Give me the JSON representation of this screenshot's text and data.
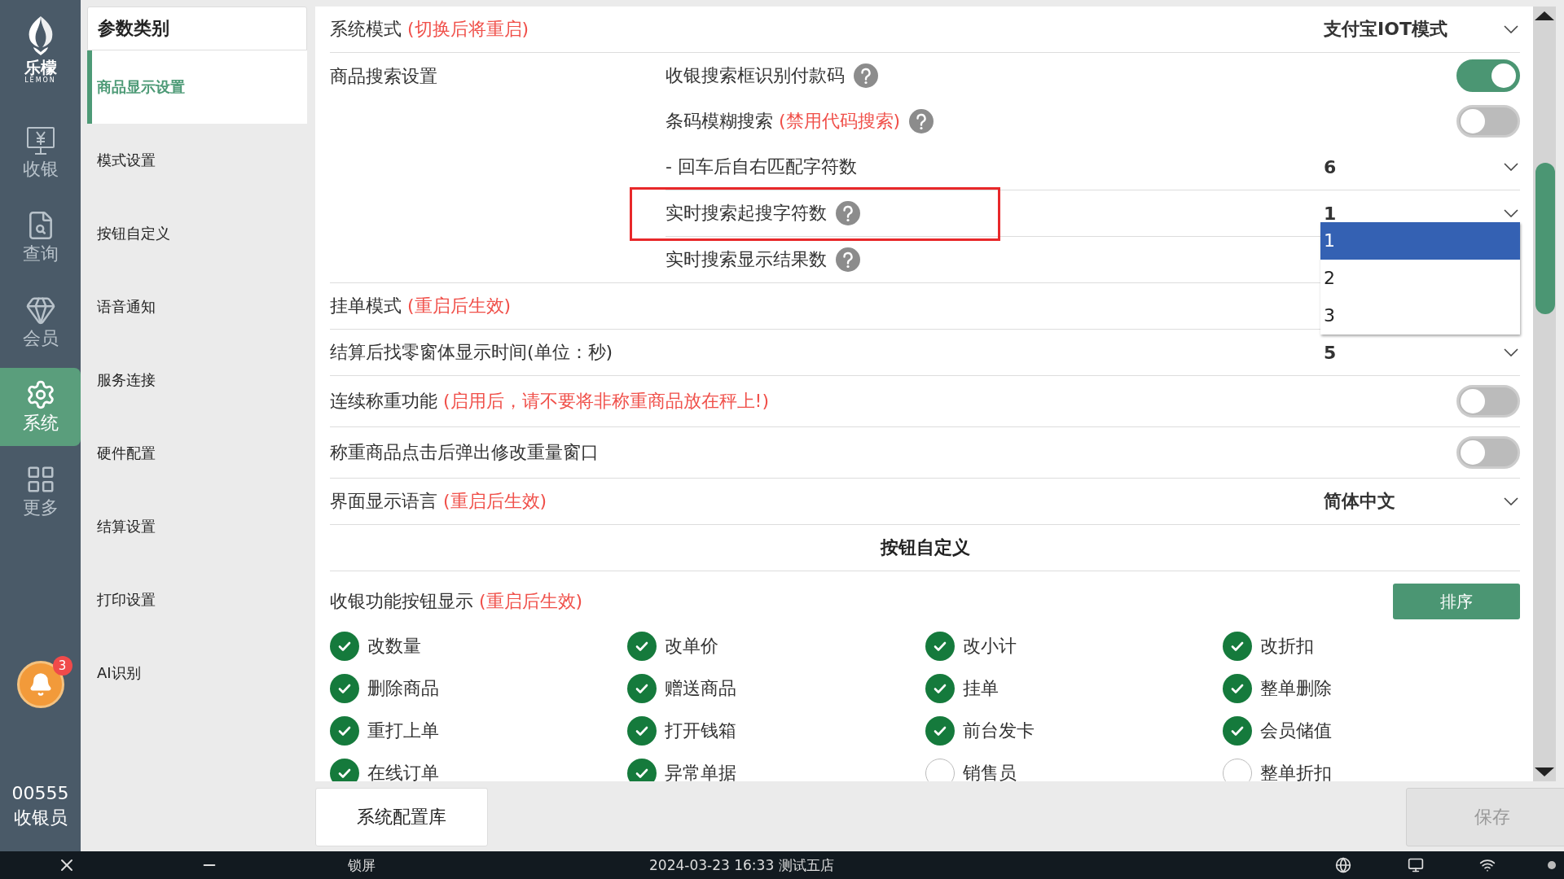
{
  "sidebar": {
    "logo": {
      "name": "乐檬",
      "subtitle": "LEMON"
    },
    "items": [
      {
        "label": "收银",
        "selected": false
      },
      {
        "label": "查询",
        "selected": false
      },
      {
        "label": "会员",
        "selected": false
      },
      {
        "label": "系统",
        "selected": true
      },
      {
        "label": "更多",
        "selected": false
      }
    ],
    "notifications": {
      "count": "3"
    },
    "user": {
      "id": "00555",
      "role": "收银员"
    }
  },
  "categories": {
    "title": "参数类别",
    "items": [
      {
        "label": "商品显示设置",
        "selected": true
      },
      {
        "label": "模式设置",
        "selected": false
      },
      {
        "label": "按钮自定义",
        "selected": false
      },
      {
        "label": "语音通知",
        "selected": false
      },
      {
        "label": "服务连接",
        "selected": false
      },
      {
        "label": "硬件配置",
        "selected": false
      },
      {
        "label": "结算设置",
        "selected": false
      },
      {
        "label": "打印设置",
        "selected": false
      },
      {
        "label": "AI识别",
        "selected": false
      }
    ]
  },
  "settings": [
    {
      "kind": "dropdown",
      "label": "系统模式",
      "note": "(切换后将重启)",
      "value": "支付宝IOT模式"
    },
    {
      "kind": "group",
      "label": "商品搜索设置",
      "children": [
        {
          "kind": "toggle",
          "label": "收银搜索框识别付款码",
          "help": true,
          "on": true
        },
        {
          "kind": "toggle",
          "label": "条码模糊搜索",
          "note": "(禁用代码搜索)",
          "help": true,
          "on": false
        },
        {
          "kind": "dropdown",
          "label": "- 回车后自右匹配字符数",
          "value": "6"
        },
        {
          "kind": "dropdown",
          "label": "实时搜索起搜字符数",
          "help": true,
          "value": "1",
          "highlighted": true,
          "open": true
        },
        {
          "kind": "plain",
          "label": "实时搜索显示结果数",
          "help": true
        }
      ]
    },
    {
      "kind": "plain",
      "label": "挂单模式",
      "note": "(重启后生效)"
    },
    {
      "kind": "dropdown",
      "label": "结算后找零窗体显示时间(单位：秒)",
      "value": "5"
    },
    {
      "kind": "toggle",
      "label": "连续称重功能",
      "note": "(启用后，请不要将非称重商品放在秤上!)",
      "on": false
    },
    {
      "kind": "toggle",
      "label": "称重商品点击后弹出修改重量窗口",
      "on": false
    },
    {
      "kind": "dropdown",
      "label": "界面显示语言",
      "note": "(重启后生效)",
      "value": "简体中文"
    }
  ],
  "dropdown_menu": {
    "options": [
      {
        "label": "1",
        "selected": true
      },
      {
        "label": "2",
        "selected": false
      },
      {
        "label": "3",
        "selected": false
      }
    ]
  },
  "button_section": {
    "title": "按钮自定义",
    "label": "收银功能按钮显示",
    "note": "(重启后生效)",
    "sort_button": "排序",
    "items": [
      {
        "label": "改数量",
        "checked": true
      },
      {
        "label": "改单价",
        "checked": true
      },
      {
        "label": "改小计",
        "checked": true
      },
      {
        "label": "改折扣",
        "checked": true
      },
      {
        "label": "删除商品",
        "checked": true
      },
      {
        "label": "赠送商品",
        "checked": true
      },
      {
        "label": "挂单",
        "checked": true
      },
      {
        "label": "整单删除",
        "checked": true
      },
      {
        "label": "重打上单",
        "checked": true
      },
      {
        "label": "打开钱箱",
        "checked": true
      },
      {
        "label": "前台发卡",
        "checked": true
      },
      {
        "label": "会员储值",
        "checked": true
      },
      {
        "label": "在线订单",
        "checked": true
      },
      {
        "label": "异常单据",
        "checked": true
      },
      {
        "label": "销售员",
        "checked": false
      },
      {
        "label": "整单折扣",
        "checked": false
      }
    ]
  },
  "footer": {
    "config_button": "系统配置库",
    "save_button": {
      "label": "保存",
      "disabled": true
    }
  },
  "taskbar": {
    "lock": "锁屏",
    "status": "2024-03-23 16:33 测试五店"
  }
}
